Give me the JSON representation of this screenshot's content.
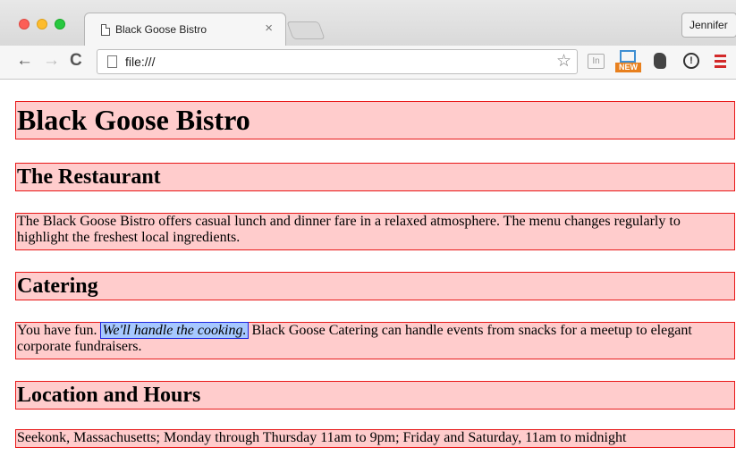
{
  "browser": {
    "tab_title": "Black Goose Bistro",
    "tab_close": "×",
    "profile_name": "Jennifer",
    "address_url": "file:///",
    "nav_back": "←",
    "nav_forward": "→",
    "nav_reload": "C",
    "bookmark_star": "☆",
    "extensions": {
      "in_label": "In",
      "new_label": "NEW",
      "info_label": "!"
    }
  },
  "page": {
    "title": "Black Goose Bistro",
    "sections": [
      {
        "heading": "The Restaurant",
        "paragraph": "The Black Goose Bistro offers casual lunch and dinner fare in a relaxed atmosphere. The menu changes regularly to highlight the freshest local ingredients."
      },
      {
        "heading": "Catering",
        "paragraph_before": "You have fun. ",
        "emphasis": "We'll handle the cooking.",
        "paragraph_after": " Black Goose Catering can handle events from snacks for a meetup to elegant corporate fundraisers."
      },
      {
        "heading": "Location and Hours",
        "paragraph": "Seekonk, Massachusetts; Monday through Thursday 11am to 9pm; Friday and Saturday, 11am to midnight"
      }
    ]
  },
  "colors": {
    "box_background": "#ffcccc",
    "box_border": "#e81818",
    "highlight_background": "#a6c8ff",
    "highlight_border": "#1c24e0"
  },
  "icons": [
    "page-icon",
    "close-icon",
    "back-arrow-icon",
    "forward-arrow-icon",
    "reload-icon",
    "star-icon",
    "linkedin-icon",
    "new-extension-icon",
    "evernote-icon",
    "info-icon",
    "menu-icon"
  ]
}
